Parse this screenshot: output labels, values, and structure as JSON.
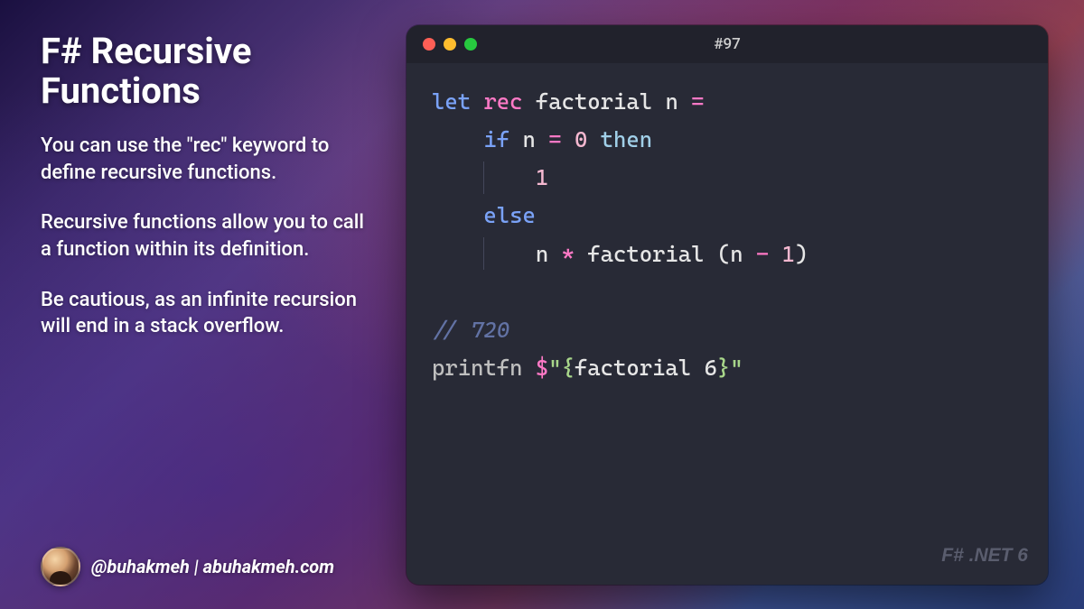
{
  "left": {
    "title": "F# Recursive Functions",
    "para1": "You can use the \"rec\" keyword to define recursive functions.",
    "para2": "Recursive functions allow you to call a function within its definition.",
    "para3": "Be cautious, as an infinite recursion will end in a stack overflow.",
    "handle": "@buhakmeh",
    "sep": "  |  ",
    "site": "abuhakmeh.com"
  },
  "editor": {
    "title": "#97",
    "watermark": "F# .NET 6",
    "code": {
      "l1": {
        "let": "let",
        "rec": "rec",
        "name": "factorial",
        "param": "n",
        "eq": "="
      },
      "l2": {
        "if": "if",
        "var": "n",
        "eq": "=",
        "zero": "0",
        "then": "then"
      },
      "l3": {
        "one": "1"
      },
      "l4": {
        "else": "else"
      },
      "l5": {
        "n": "n",
        "star": "*",
        "call": "factorial",
        "open": "(n",
        "minus": "-",
        "close": "1)",
        "onearg": "1"
      },
      "l6": {
        "comment": "// 720"
      },
      "l7": {
        "printfn": "printfn",
        "dollar": "$",
        "str_open": "\"{",
        "expr": "factorial 6",
        "str_close": "}\""
      }
    }
  }
}
